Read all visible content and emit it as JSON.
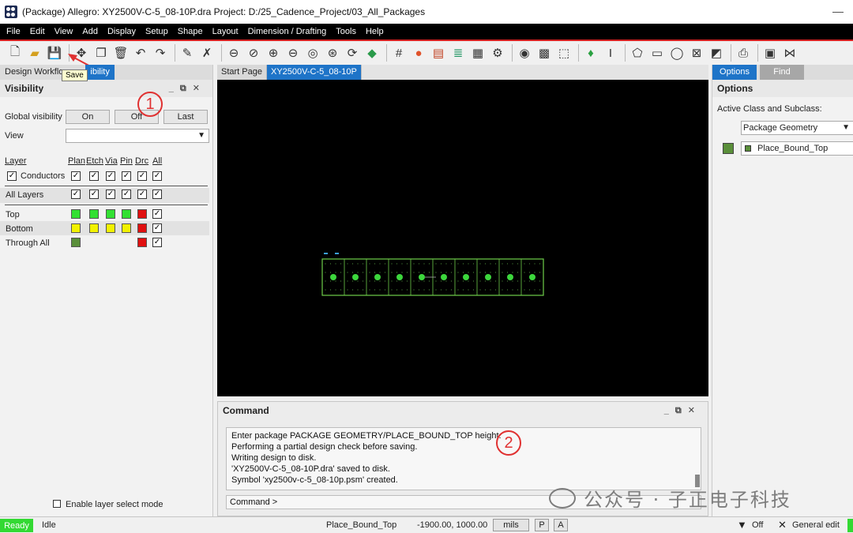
{
  "titlebar": {
    "title": "(Package) Allegro: XY2500V-C-5_08-10P.dra  Project: D:/25_Cadence_Project/03_All_Packages",
    "minimize": "—"
  },
  "menu": [
    "File",
    "Edit",
    "View",
    "Add",
    "Display",
    "Setup",
    "Shape",
    "Layout",
    "Dimension / Drafting",
    "Tools",
    "Help"
  ],
  "tooltip": "Save",
  "left_panel": {
    "tabs": [
      "Design Workflo",
      "ibility"
    ],
    "header": "Visibility",
    "global_visibility_label": "Global visibility",
    "buttons": [
      "On",
      "Off",
      "Last"
    ],
    "view_label": "View",
    "view_value": "",
    "columns": [
      "Layer",
      "Plan",
      "Etch",
      "Via",
      "Pin",
      "Drc",
      "All"
    ],
    "conductors_label": "Conductors",
    "all_layers_label": "All Layers",
    "layers": [
      {
        "name": "Top",
        "colors": [
          "#33e033",
          "#33e033",
          "#33e033",
          "#33e033",
          "#e01010"
        ]
      },
      {
        "name": "Bottom",
        "colors": [
          "#f2f200",
          "#f2f200",
          "#f2f200",
          "#f2f200",
          "#e01010"
        ]
      },
      {
        "name": "Through All",
        "colors": [
          "#5a8f3a",
          "",
          "",
          "",
          "#e01010"
        ]
      }
    ],
    "enable_select": "Enable layer select mode"
  },
  "canvas": {
    "tabs": [
      "Start Page",
      "XY2500V-C-5_08-10P"
    ],
    "pin_count": 10,
    "outline_color": "#6fcf4a",
    "pin_color": "#3cd63c"
  },
  "command": {
    "header": "Command",
    "log": [
      "Enter package PACKAGE GEOMETRY/PLACE_BOUND_TOP height.",
      "Performing a partial design check before saving.",
      "Writing design to disk.",
      "'XY2500V-C-5_08-10P.dra' saved to disk.",
      "Symbol 'xy2500v-c-5_08-10p.psm' created."
    ],
    "prompt": "Command >"
  },
  "right_panel": {
    "tabs": [
      "Options",
      "Find"
    ],
    "header": "Options",
    "active_class_label": "Active Class and Subclass:",
    "class_value": "Package Geometry",
    "subclass_value": "Place_Bound_Top",
    "subclass_color": "#5a8f3a"
  },
  "status": {
    "ready": "Ready",
    "idle": "Idle",
    "subclass": "Place_Bound_Top",
    "coords": "-1900.00, 1000.00",
    "units": "mils",
    "p": "P",
    "a": "A",
    "filter": "Off",
    "mode": "General edit"
  },
  "annotations": [
    "1",
    "2"
  ],
  "watermark": "公众号 · 子正电子科技"
}
